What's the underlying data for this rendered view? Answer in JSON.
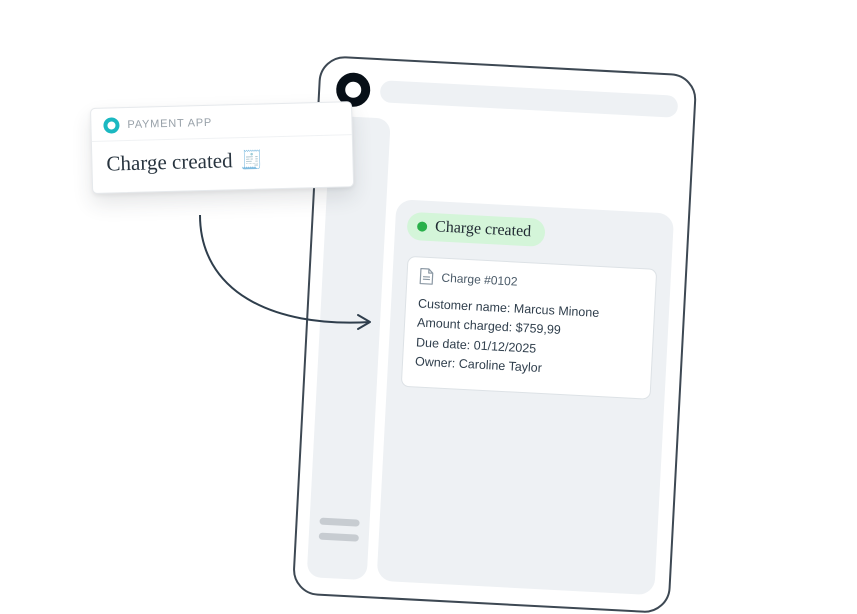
{
  "notification": {
    "app_name": "PAYMENT APP",
    "title": "Charge created",
    "emoji": "🧾"
  },
  "panel": {
    "status_label": "Charge created"
  },
  "charge": {
    "card_title": "Charge #0102",
    "fields": {
      "customer_name": {
        "label": "Customer name:",
        "value": "Marcus Minone"
      },
      "amount_charged": {
        "label": "Amount charged:",
        "value": "$759,99"
      },
      "due_date": {
        "label": "Due date:",
        "value": "01/12/2025"
      },
      "owner": {
        "label": "Owner:",
        "value": "Caroline Taylor"
      }
    }
  }
}
